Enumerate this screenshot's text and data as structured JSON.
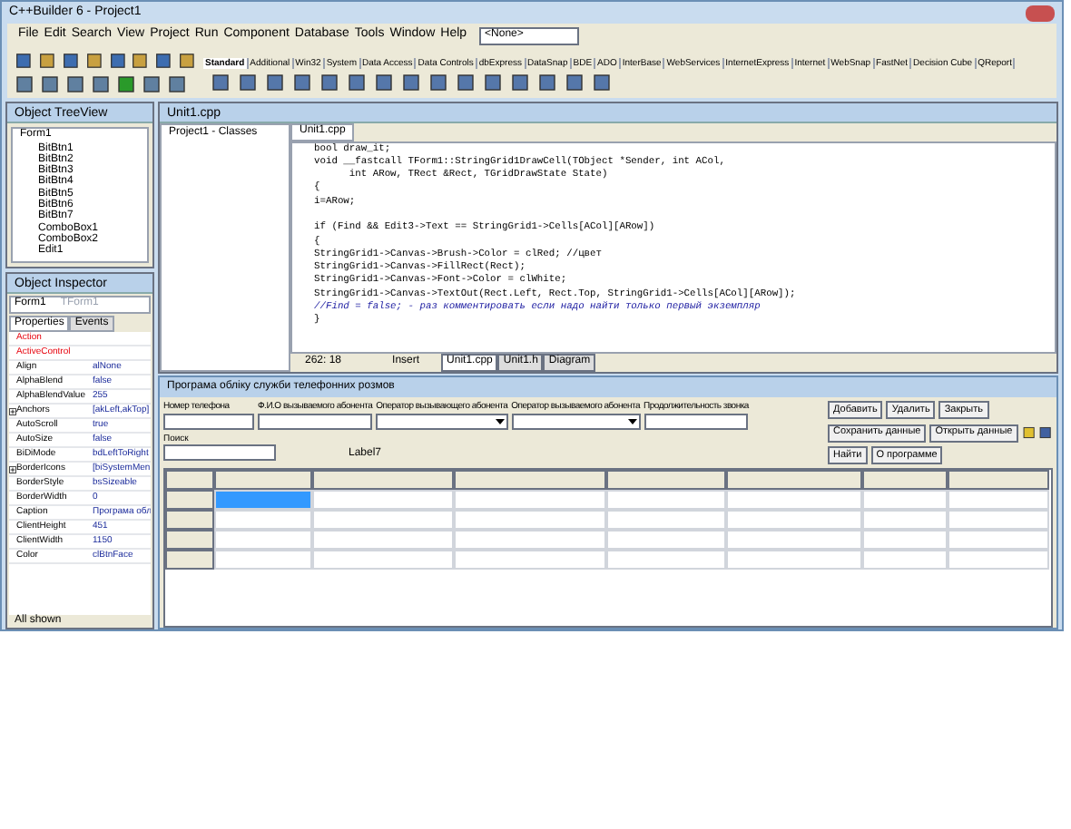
{
  "window": {
    "title": "C++Builder 6 - Project1"
  },
  "menu": [
    "File",
    "Edit",
    "Search",
    "View",
    "Project",
    "Run",
    "Component",
    "Database",
    "Tools",
    "Window",
    "Help"
  ],
  "config_dropdown": {
    "value": "<None>"
  },
  "palette_tabs": [
    {
      "label": "Standard",
      "selected": true
    },
    {
      "label": "Additional",
      "selected": false
    },
    {
      "label": "Win32",
      "selected": false
    },
    {
      "label": "System",
      "selected": false
    },
    {
      "label": "Data Access",
      "selected": false
    },
    {
      "label": "Data Controls",
      "selected": false
    },
    {
      "label": "dbExpress",
      "selected": false
    },
    {
      "label": "DataSnap",
      "selected": false
    },
    {
      "label": "BDE",
      "selected": false
    },
    {
      "label": "ADO",
      "selected": false
    },
    {
      "label": "InterBase",
      "selected": false
    },
    {
      "label": "WebServices",
      "selected": false
    },
    {
      "label": "InternetExpress",
      "selected": false
    },
    {
      "label": "Internet",
      "selected": false
    },
    {
      "label": "WebSnap",
      "selected": false
    },
    {
      "label": "FastNet",
      "selected": false
    },
    {
      "label": "Decision Cube",
      "selected": false
    },
    {
      "label": "QReport",
      "selected": false
    }
  ],
  "tree_view": {
    "title": "Object TreeView",
    "root": "Form1",
    "children": [
      "BitBtn1",
      "BitBtn2",
      "BitBtn3",
      "BitBtn4",
      "BitBtn5",
      "BitBtn6",
      "BitBtn7",
      "ComboBox1",
      "ComboBox2",
      "Edit1"
    ]
  },
  "inspector": {
    "title": "Object Inspector",
    "object": "Form1",
    "object_type": "TForm1",
    "tabs": [
      {
        "label": "Properties",
        "selected": true
      },
      {
        "label": "Events",
        "selected": false
      }
    ],
    "properties": [
      {
        "name": "Action",
        "linked": true,
        "expandable": false
      },
      {
        "name": "ActiveControl",
        "linked": true,
        "expandable": false
      },
      {
        "name": "Align",
        "value": "alNone",
        "linked": false,
        "expandable": false
      },
      {
        "name": "AlphaBlend",
        "value": "false",
        "linked": false,
        "expandable": false
      },
      {
        "name": "AlphaBlendValue",
        "value": "255",
        "linked": false,
        "expandable": false
      },
      {
        "name": "Anchors",
        "value": "[akLeft,akTop]",
        "linked": false,
        "expandable": true
      },
      {
        "name": "AutoScroll",
        "value": "true",
        "linked": false,
        "expandable": false
      },
      {
        "name": "AutoSize",
        "value": "false",
        "linked": false,
        "expandable": false
      },
      {
        "name": "BiDiMode",
        "value": "bdLeftToRight",
        "linked": false,
        "expandable": false
      },
      {
        "name": "BorderIcons",
        "value": "[biSystemMen",
        "linked": false,
        "expandable": true
      },
      {
        "name": "BorderStyle",
        "value": "bsSizeable",
        "linked": false,
        "expandable": false
      },
      {
        "name": "BorderWidth",
        "value": "0",
        "linked": false,
        "expandable": false
      },
      {
        "name": "Caption",
        "value": "Програма обл",
        "linked": false,
        "expandable": false
      },
      {
        "name": "ClientHeight",
        "value": "451",
        "linked": false,
        "expandable": false
      },
      {
        "name": "ClientWidth",
        "value": "1150",
        "linked": false,
        "expandable": false
      },
      {
        "name": "Color",
        "value": "clBtnFace",
        "linked": false,
        "expandable": false
      }
    ],
    "status": "All shown"
  },
  "editor": {
    "title": "Unit1.cpp",
    "class_tree": "Project1 - Classes",
    "tab": "Unit1.cpp",
    "lines": [
      {
        "text": "bool draw_it;",
        "kind": "code"
      },
      {
        "text": "void __fastcall TForm1::StringGrid1DrawCell(TObject *Sender, int ACol,",
        "kind": "code"
      },
      {
        "text": "      int ARow, TRect &Rect, TGridDrawState State)",
        "kind": "code"
      },
      {
        "text": "{",
        "kind": "code"
      },
      {
        "text": "i=ARow;",
        "kind": "code"
      },
      {
        "kind": "blank"
      },
      {
        "text": "if (Find && Edit3->Text == StringGrid1->Cells[ACol][ARow])",
        "kind": "code"
      },
      {
        "text": "{",
        "kind": "code"
      },
      {
        "text": "StringGrid1->Canvas->Brush->Color = clRed; //цвет",
        "kind": "code"
      },
      {
        "text": "StringGrid1->Canvas->FillRect(Rect);",
        "kind": "code"
      },
      {
        "text": "StringGrid1->Canvas->Font->Color = clWhite;",
        "kind": "code"
      },
      {
        "text": "StringGrid1->Canvas->TextOut(Rect.Left, Rect.Top, StringGrid1->Cells[ACol][ARow]);",
        "kind": "code"
      },
      {
        "text": "//Find = false; - раз комментировать если надо найти только первый экземпляр",
        "kind": "comment"
      },
      {
        "text": "}",
        "kind": "code"
      }
    ],
    "position": "262: 18",
    "mode": "Insert",
    "bottom_tabs": [
      {
        "label": "Unit1.cpp",
        "selected": true
      },
      {
        "label": "Unit1.h",
        "selected": false
      },
      {
        "label": "Diagram",
        "selected": false
      }
    ]
  },
  "form": {
    "title": "Програма обліку служби телефонних розмов",
    "fields": [
      {
        "label": "Номер телефона",
        "kind": "edit"
      },
      {
        "label": "Ф.И.О вызываемого абонента",
        "kind": "edit"
      },
      {
        "label": "Оператор вызывающего абонента",
        "kind": "combo"
      },
      {
        "label": "Оператор вызываемого абонента",
        "kind": "combo"
      },
      {
        "label": "Продолжительность звонка",
        "kind": "edit"
      }
    ],
    "search_label": "Поиск",
    "label7": "Label7",
    "buttons_row1": [
      "Добавить",
      "Удалить",
      "Закрыть"
    ],
    "buttons_row2": [
      "Сохранить данные",
      "Открыть данные"
    ],
    "buttons_row3": [
      "Найти",
      "О программе"
    ],
    "grid": {
      "rows": [
        [
          {
            "selected": false
          },
          {
            "selected": true
          },
          {
            "selected": false
          },
          {
            "selected": false
          },
          {
            "selected": false
          },
          {
            "selected": false
          },
          {
            "selected": false
          },
          {
            "selected": false
          }
        ],
        [
          {
            "selected": false
          },
          {
            "selected": false
          },
          {
            "selected": false
          },
          {
            "selected": false
          },
          {
            "selected": false
          },
          {
            "selected": false
          },
          {
            "selected": false
          },
          {
            "selected": false
          }
        ],
        [
          {
            "selected": false
          },
          {
            "selected": false
          },
          {
            "selected": false
          },
          {
            "selected": false
          },
          {
            "selected": false
          },
          {
            "selected": false
          },
          {
            "selected": false
          },
          {
            "selected": false
          }
        ],
        [
          {
            "selected": false
          },
          {
            "selected": false
          },
          {
            "selected": false
          },
          {
            "selected": false
          },
          {
            "selected": false
          },
          {
            "selected": false
          },
          {
            "selected": false
          },
          {
            "selected": false
          }
        ]
      ]
    }
  }
}
